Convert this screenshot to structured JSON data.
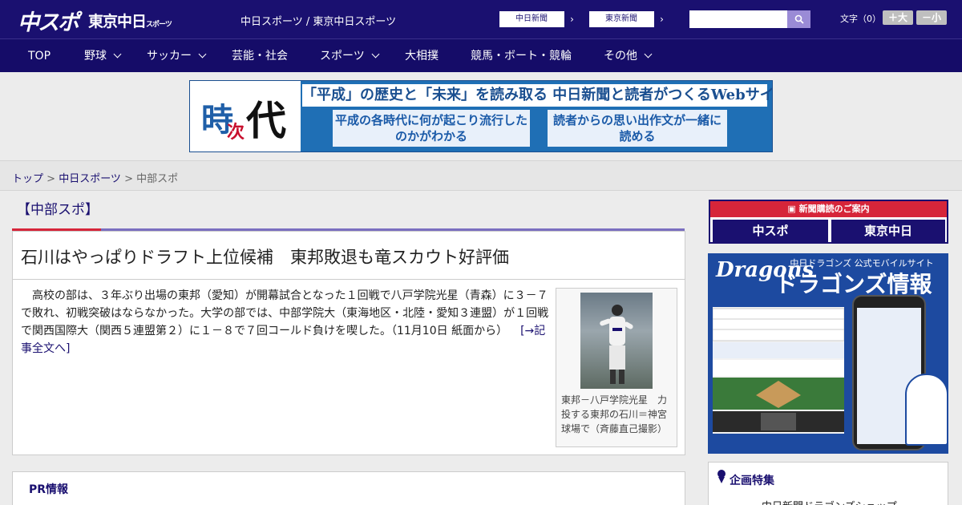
{
  "header": {
    "logo_chunichi_sports": "中スポ",
    "logo_tokyo_chunichi": "東京中日",
    "logo_tokyo_chunichi_sub": "スポーツ",
    "site_links": "中日スポーツ / 東京中日スポーツ",
    "site_buttons": [
      {
        "label": "中日新聞",
        "arrow": "›"
      },
      {
        "label": "東京新聞",
        "arrow": "›"
      }
    ],
    "search_placeholder": "",
    "fontsize_label": "文字（0）",
    "fontsize_larger": "＋大",
    "fontsize_smaller": "－小"
  },
  "nav": {
    "items": [
      {
        "label": "TOP",
        "dropdown": false
      },
      {
        "label": "野球",
        "dropdown": true
      },
      {
        "label": "サッカー",
        "dropdown": true
      },
      {
        "label": "芸能・社会",
        "dropdown": false
      },
      {
        "label": "スポーツ",
        "dropdown": true
      },
      {
        "label": "大相撲",
        "dropdown": false
      },
      {
        "label": "競馬・ボート・競輪",
        "dropdown": false
      },
      {
        "label": "その他",
        "dropdown": true
      }
    ]
  },
  "banner": {
    "logo_ji": "時",
    "logo_ji2": "次",
    "logo_dai": "代",
    "headline": "「平成」の歴史と「未来」を読み取る 中日新聞と読者がつくるWebサイト",
    "box1": "平成の各時代に何が起こり流行したのかがわかる",
    "box2": "読者からの思い出作文が一緒に読める"
  },
  "breadcrumb": {
    "home": "トップ",
    "sep": " > ",
    "section": "中日スポーツ",
    "current": "中部スポ"
  },
  "section": {
    "title": "【中部スポ】"
  },
  "article": {
    "title": "石川はやっぱりドラフト上位候補　東邦敗退も竜スカウト好評価",
    "body": "　高校の部は、３年ぶり出場の東邦（愛知）が開幕試合となった１回戦で八戸学院光星（青森）に３－７で敗れ、初戦突破はならなかった。大学の部では、中部学院大（東海地区・北陸・愛知３連盟）が１回戦で関西国際大（関西５連盟第２）に１－８で７回コールド負けを喫した。（11月10日 紙面から）",
    "read_more": "[→記事全文へ]",
    "photo_caption": "東邦－八戸学院光星　力投する東邦の石川＝神宮球場で（斉藤直己撮影）"
  },
  "pr": {
    "title": "PR情報"
  },
  "sidebar": {
    "subscribe_header": "新聞購読のご案内",
    "subscribe_logo1": "中スポ",
    "subscribe_logo2": "東京中日",
    "ad_logo": "Dragons",
    "ad_sub": "中日ドラゴンズ 公式モバイルサイト",
    "ad_big": "ドラゴンズ情報",
    "feature_title": "企画特集",
    "feature_item": "中日新聞ドラゴンズショップ"
  },
  "colors": {
    "header_bg": "#1a1070",
    "accent_red": "#d6253a",
    "link": "#1a1070"
  }
}
